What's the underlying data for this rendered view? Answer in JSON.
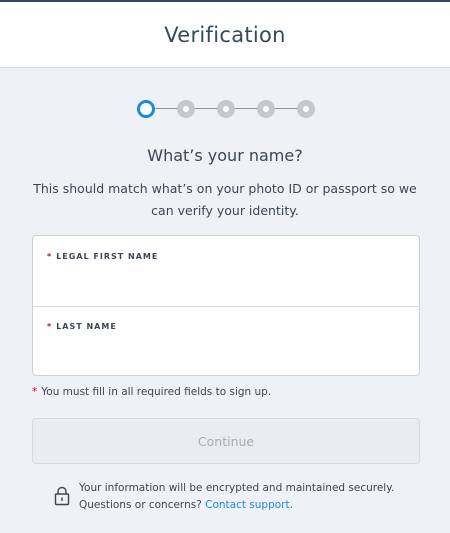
{
  "header": {
    "title": "Verification"
  },
  "stepper": {
    "total": 5,
    "current": 1
  },
  "main": {
    "heading": "What’s your name?",
    "subtext": "This should match what’s on your photo ID or passport so we can verify your identity."
  },
  "form": {
    "first_name_label": "LEGAL FIRST NAME",
    "first_name_value": "",
    "last_name_label": "LAST NAME",
    "last_name_value": "",
    "required_marker": "*",
    "required_note": "You must fill in all required fields to sign up.",
    "continue_label": "Continue"
  },
  "footer": {
    "security_line1": "Your information will be encrypted and maintained securely.",
    "security_line2": "Questions or concerns?",
    "support_link": "Contact support",
    "support_period": "."
  },
  "colors": {
    "accent": "#1c8bd9",
    "required": "#d0021b",
    "header_text": "#34495e"
  },
  "icons": {
    "lock": "lock-icon"
  }
}
